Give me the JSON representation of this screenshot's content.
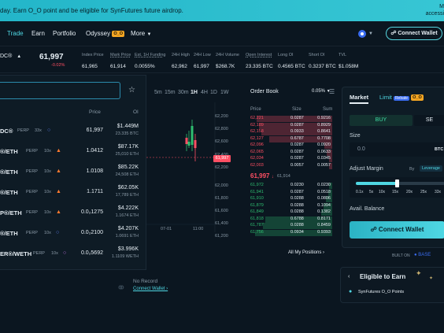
{
  "banner": {
    "message": "day. Earn O_O point and be eligible for SynFutures future airdrop.",
    "right_line1": "M",
    "right_line2": "accessi"
  },
  "nav": {
    "items": [
      "Trade",
      "Earn",
      "Portfolio",
      "Odyssey",
      "More"
    ],
    "odyssey_badge": "O_O",
    "connect": "Connect Wallet"
  },
  "ticker": {
    "pair_suffix": "DC®",
    "price": "61,997",
    "change": "-0.02%",
    "stats": [
      {
        "label": "Index Price",
        "value": "61,965"
      },
      {
        "label": "Mark Price",
        "value": "61,914"
      },
      {
        "label": "Est. 1H Funding",
        "value": "0.0055%"
      },
      {
        "label": "24H High",
        "value": "62,962"
      },
      {
        "label": "24H Low",
        "value": "61,997"
      },
      {
        "label": "24H Volume",
        "value": "$268.7K"
      },
      {
        "label": "Open Interest",
        "value": "23.335 BTC"
      },
      {
        "label": "Long OI",
        "value": "0.4565 BTC"
      },
      {
        "label": "Short OI",
        "value": "0.3237 BTC"
      },
      {
        "label": "TVL",
        "value": "$1.058M"
      }
    ]
  },
  "market_list": {
    "col_price": "Price",
    "col_oi": "OI",
    "rows": [
      {
        "name": "DC®",
        "tag": "PERP",
        "lev": "33x",
        "price": "61,997",
        "oi": "$1.449M",
        "oi_sub": "23.335 BTC",
        "icon": "circle-icon"
      },
      {
        "name": "®/ETH",
        "tag": "PERP",
        "lev": "10x",
        "price": "1.0412",
        "oi": "$87.17K",
        "oi_sub": "25,010 ETH",
        "icon": "fire-icon"
      },
      {
        "name": "®/ETH",
        "tag": "PERP",
        "lev": "10x",
        "price": "1.0108",
        "oi": "$85.22K",
        "oi_sub": "24,508 ETH",
        "icon": "fire-icon"
      },
      {
        "name": "®/ETH",
        "tag": "PERP",
        "lev": "10x",
        "price": "1.1711",
        "oi": "$62.05K",
        "oi_sub": "17,789 ETH",
        "icon": "fire-icon"
      },
      {
        "name": "P®/ETH",
        "tag": "PERP",
        "lev": "10x",
        "price": "0.0₂1275",
        "oi": "$4.222K",
        "oi_sub": "1.1674 ETH",
        "icon": "fire-icon"
      },
      {
        "name": "®/ETH",
        "tag": "PERP",
        "lev": "10x",
        "price": "0.0₂2100",
        "oi": "$4.207K",
        "oi_sub": "1.0691 ETH",
        "icon": "circle-icon"
      },
      {
        "name": "ER®/WETH",
        "tag": "PERP",
        "lev": "10x",
        "price": "0.0₂5692",
        "oi": "$3.996K",
        "oi_sub": "1.1109 WETH",
        "icon": "circle-icon"
      }
    ]
  },
  "timeframes": [
    "5m",
    "15m",
    "30m",
    "1H",
    "4H",
    "1D",
    "1W"
  ],
  "chart": {
    "y_labels": [
      "62,200",
      "62,800",
      "62,600",
      "62,400",
      "62,200",
      "62,000",
      "61,800",
      "61,600",
      "61,400",
      "61,200"
    ],
    "current_label": "61,997",
    "x_labels": [
      "07-01",
      "11:00"
    ]
  },
  "orderbook": {
    "title": "Order Book",
    "decimals": "0.05%",
    "headers": [
      "Price",
      "Size",
      "Sum"
    ],
    "asks": [
      [
        "62,221",
        "0.0287",
        "0.9216"
      ],
      [
        "62,189",
        "0.0287",
        "0.8929"
      ],
      [
        "62,158",
        "0.0933",
        "0.8641"
      ],
      [
        "62,127",
        "0.6787",
        "0.7708"
      ],
      [
        "62,096",
        "0.0287",
        "0.0920"
      ],
      [
        "62,065",
        "0.0287",
        "0.0633"
      ],
      [
        "62,034",
        "0.0287",
        "0.0345"
      ],
      [
        "62,003",
        "0.0057",
        "0.0057"
      ]
    ],
    "mid": "61,997",
    "mid_sub": "61,914",
    "bids": [
      [
        "61,972",
        "0.0230",
        "0.0230"
      ],
      [
        "61,941",
        "0.0287",
        "0.0518"
      ],
      [
        "61,910",
        "0.0288",
        "0.0806"
      ],
      [
        "61,879",
        "0.0288",
        "0.1094"
      ],
      [
        "61,849",
        "0.0288",
        "0.1382"
      ],
      [
        "61,818",
        "0.6788",
        "0.8171"
      ],
      [
        "61,787",
        "0.0288",
        "0.8459"
      ],
      [
        "61,756",
        "0.0934",
        "0.9393"
      ]
    ]
  },
  "positions": {
    "all_label": "All My Positions",
    "no_record": "No Record",
    "connect_link": "Connect Wallet ›"
  },
  "trade_panel": {
    "tabs": [
      "Market",
      "Limit"
    ],
    "limit_badge": "Rebate",
    "limit_badge2": "O_O",
    "buy": "BUY",
    "sell": "SE",
    "size_label": "Size",
    "size_placeholder": "0.0",
    "size_unit": "BTC",
    "adjust_margin": "Adjust Margin",
    "by": "By",
    "by_value": "Leverage",
    "lev_ticks": [
      "0.1x",
      "5x",
      "10x",
      "15x",
      "20x",
      "25x",
      "33x"
    ],
    "leverage_fraction": 0.46,
    "avail_balance": "Avail. Balance",
    "connect": "Connect Wallet",
    "built_on": "BUILT ON",
    "base": "BASE"
  },
  "eligible": {
    "title": "Eligible to Earn",
    "item": "SynFutures O_O Points"
  }
}
